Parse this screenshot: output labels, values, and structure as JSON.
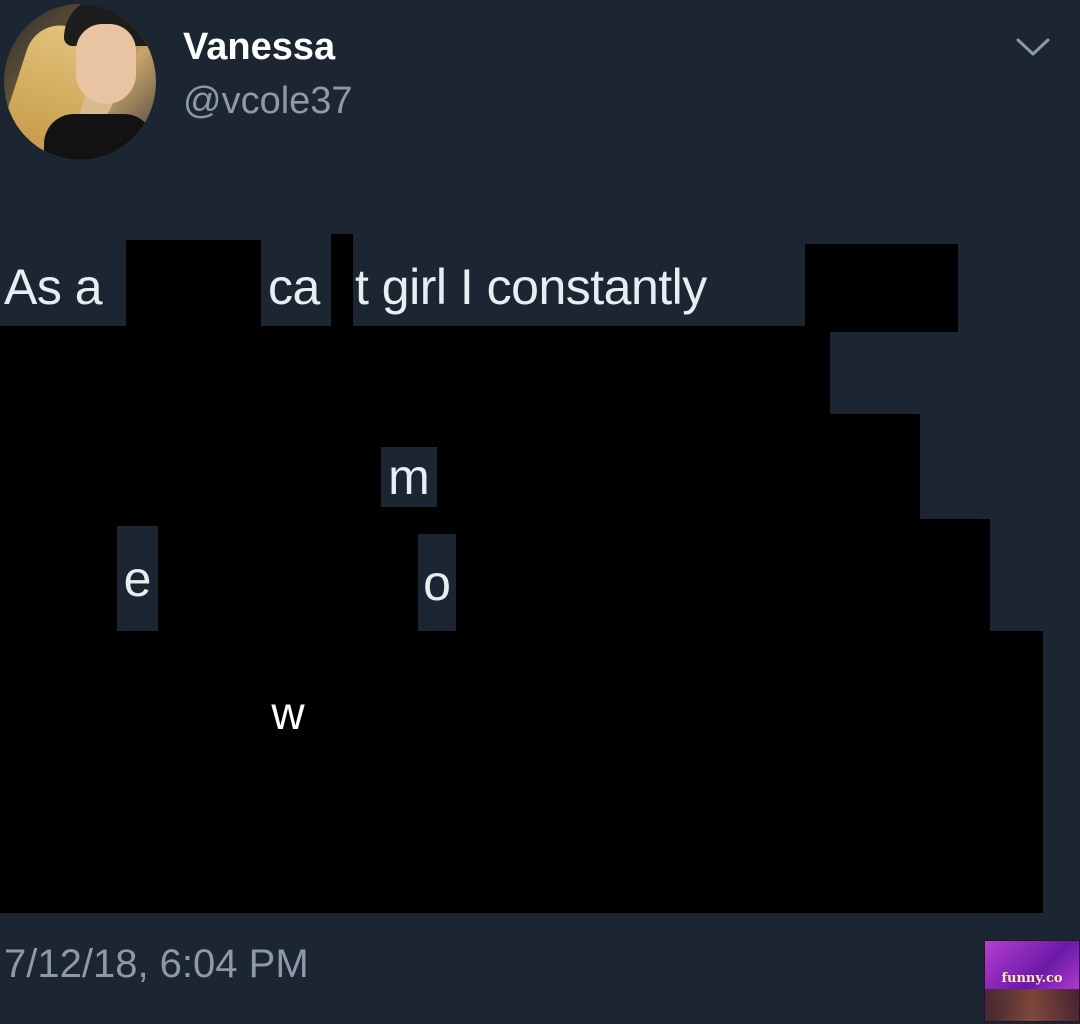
{
  "author": {
    "display_name": "Vanessa",
    "handle": "@vcole37",
    "avatar_icon": "profile-photo"
  },
  "tweet": {
    "line1_start": "As a",
    "line1_mid": "ca",
    "line1_end": "t girl I constantly",
    "frag_m": "m",
    "frag_e": "e",
    "frag_o": "o",
    "frag_w": "w"
  },
  "timestamp": "7/12/18, 6:04 PM",
  "menu_icon": "chevron-down-icon",
  "watermark": {
    "text": "funny.co"
  },
  "colors": {
    "background": "#1c2532",
    "text": "#e8edf2",
    "secondary": "#8d99a6",
    "redaction": "#000000"
  }
}
